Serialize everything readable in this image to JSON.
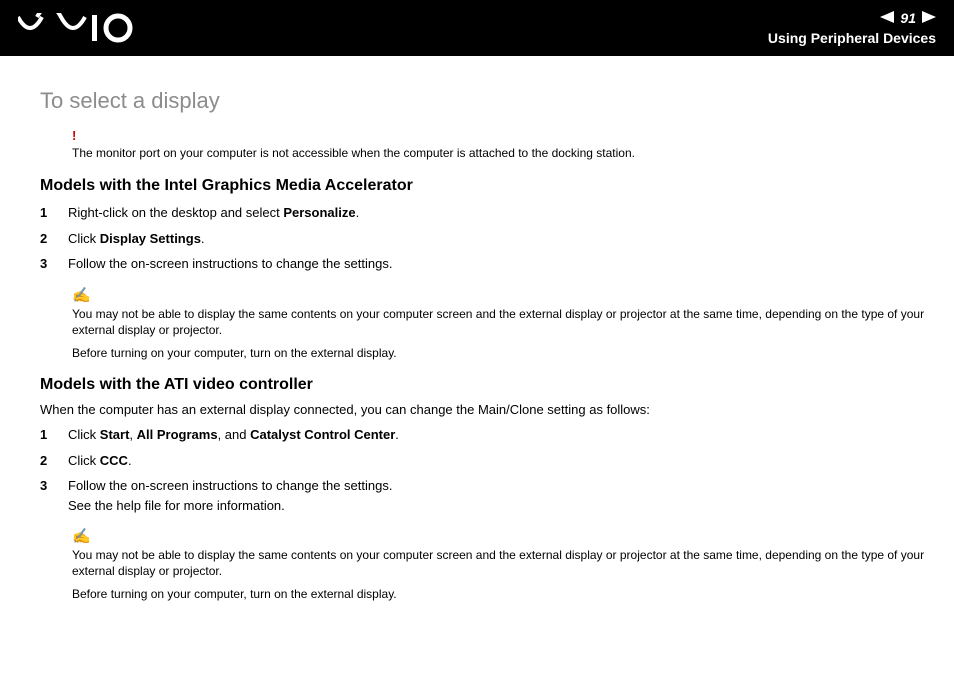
{
  "header": {
    "page_number": "91",
    "section": "Using Peripheral Devices"
  },
  "page_title": "To select a display",
  "warning": {
    "mark": "!",
    "text": "The monitor port on your computer is not accessible when the computer is attached to the docking station."
  },
  "section1": {
    "heading": "Models with the Intel Graphics Media Accelerator",
    "steps": [
      {
        "num": "1",
        "pre": "Right-click on the desktop and select ",
        "bold": "Personalize",
        "post": "."
      },
      {
        "num": "2",
        "pre": "Click ",
        "bold": "Display Settings",
        "post": "."
      },
      {
        "num": "3",
        "pre": "Follow the on-screen instructions to change the settings.",
        "bold": "",
        "post": ""
      }
    ],
    "note": "You may not be able to display the same contents on your computer screen and the external display or projector at the same time, depending on the type of your external display or projector.",
    "followup": "Before turning on your computer, turn on the external display."
  },
  "section2": {
    "heading": "Models with the ATI video controller",
    "intro": "When the computer has an external display connected, you can change the Main/Clone setting as follows:",
    "step1": {
      "num": "1",
      "p1": "Click ",
      "b1": "Start",
      "p2": ", ",
      "b2": "All Programs",
      "p3": ", and ",
      "b3": "Catalyst Control Center",
      "p4": "."
    },
    "step2": {
      "num": "2",
      "pre": "Click ",
      "bold": "CCC",
      "post": "."
    },
    "step3": {
      "num": "3",
      "line1": "Follow the on-screen instructions to change the settings.",
      "line2": "See the help file for more information."
    },
    "note": "You may not be able to display the same contents on your computer screen and the external display or projector at the same time, depending on the type of your external display or projector.",
    "followup": "Before turning on your computer, turn on the external display."
  },
  "icons": {
    "note_glyph": "✍"
  }
}
